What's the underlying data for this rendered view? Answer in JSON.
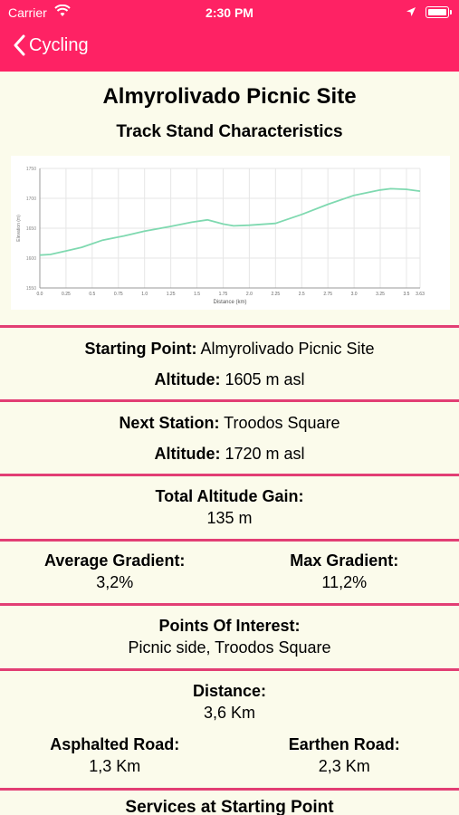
{
  "status": {
    "carrier": "Carrier",
    "time": "2:30 PM"
  },
  "nav": {
    "back_label": "Cycling"
  },
  "page": {
    "title": "Almyrolivado Picnic Site",
    "subtitle": "Track Stand Characteristics"
  },
  "chart_data": {
    "type": "line",
    "xlabel": "Distance (km)",
    "ylabel": "Elevation (m)",
    "x_ticks": [
      "0.0",
      "0.25",
      "0.5",
      "0.75",
      "1.0",
      "1.25",
      "1.5",
      "1.75",
      "2.0",
      "2.25",
      "2.5",
      "2.75",
      "3.0",
      "3.25",
      "3.5",
      "3.63"
    ],
    "y_ticks": [
      "1550",
      "1600",
      "1650",
      "1700",
      "1750"
    ],
    "xlim": [
      0,
      3.63
    ],
    "ylim": [
      1550,
      1750
    ],
    "x": [
      0,
      0.1,
      0.25,
      0.4,
      0.6,
      0.8,
      1.0,
      1.25,
      1.45,
      1.6,
      1.75,
      1.85,
      2.0,
      2.25,
      2.5,
      2.75,
      3.0,
      3.25,
      3.35,
      3.5,
      3.63
    ],
    "y": [
      1605,
      1606,
      1612,
      1618,
      1630,
      1637,
      1645,
      1653,
      1660,
      1664,
      1657,
      1654,
      1655,
      1658,
      1673,
      1690,
      1705,
      1714,
      1716,
      1715,
      1712
    ],
    "line_color": "#7fd9b0",
    "grid": true
  },
  "starting": {
    "label": "Starting Point:",
    "value": "Almyrolivado Picnic Site",
    "alt_label": "Altitude:",
    "alt_value": "1605 m asl"
  },
  "next": {
    "label": "Next Station:",
    "value": "Troodos Square",
    "alt_label": "Altitude:",
    "alt_value": "1720 m asl"
  },
  "gain": {
    "label": "Total Altitude Gain:",
    "value": "135 m"
  },
  "gradient": {
    "avg_label": "Average Gradient:",
    "avg_value": "3,2%",
    "max_label": "Max Gradient:",
    "max_value": "11,2%"
  },
  "poi": {
    "label": "Points Of Interest:",
    "value": "Picnic side, Troodos Square"
  },
  "distance": {
    "label": "Distance:",
    "value": "3,6 Km",
    "asph_label": "Asphalted Road:",
    "asph_value": "1,3 Km",
    "earth_label": "Earthen Road:",
    "earth_value": "2,3 Km"
  },
  "services": {
    "label": "Services at Starting Point"
  }
}
